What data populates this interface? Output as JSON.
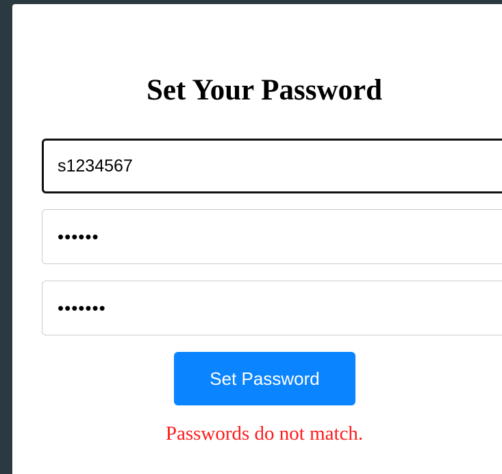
{
  "form": {
    "title": "Set Your Password",
    "username_value": "s1234567",
    "password_value": "••••••",
    "confirm_value": "•••••••",
    "submit_label": "Set Password",
    "error_message": "Passwords do not match."
  },
  "colors": {
    "background": "#2b3a40",
    "card": "#ffffff",
    "button": "#0a84ff",
    "error": "#ff1a1a"
  }
}
